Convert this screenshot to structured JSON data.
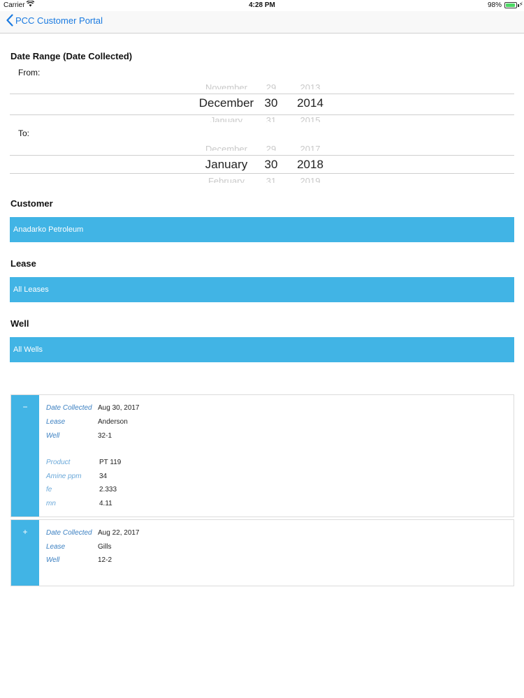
{
  "status_bar": {
    "carrier": "Carrier",
    "time": "4:28 PM",
    "battery": "98%"
  },
  "nav": {
    "back_label": "PCC Customer Portal"
  },
  "date_range": {
    "title": "Date Range (Date Collected)",
    "from_label": "From:",
    "to_label": "To:",
    "from": {
      "prev": [
        "November",
        "29",
        "2013"
      ],
      "selected": [
        "December",
        "30",
        "2014"
      ],
      "next": [
        "January",
        "31",
        "2015"
      ]
    },
    "to": {
      "prev": [
        "December",
        "29",
        "2017"
      ],
      "selected": [
        "January",
        "30",
        "2018"
      ],
      "next": [
        "February",
        "31",
        "2019"
      ]
    }
  },
  "filters": {
    "customer_label": "Customer",
    "customer_value": "Anadarko Petroleum",
    "lease_label": "Lease",
    "lease_value": "All Leases",
    "well_label": "Well",
    "well_value": "All Wells"
  },
  "results": [
    {
      "toggle": "−",
      "date_collected_label": "Date Collected",
      "date_collected": "Aug 30, 2017",
      "lease_label": "Lease",
      "lease": "Anderson",
      "well_label": "Well",
      "well": "32-1",
      "details": [
        {
          "label": "Product",
          "value": "PT 119"
        },
        {
          "label": "Amine ppm",
          "value": "34"
        },
        {
          "label": "fe",
          "value": "2.333"
        },
        {
          "label": "mn",
          "value": "4.11"
        }
      ]
    },
    {
      "toggle": "+",
      "date_collected_label": "Date Collected",
      "date_collected": "Aug 22, 2017",
      "lease_label": "Lease",
      "lease": "Gills",
      "well_label": "Well",
      "well": "12-2"
    }
  ],
  "colors": {
    "accent": "#41b4e5",
    "link": "#1a7ae0"
  }
}
